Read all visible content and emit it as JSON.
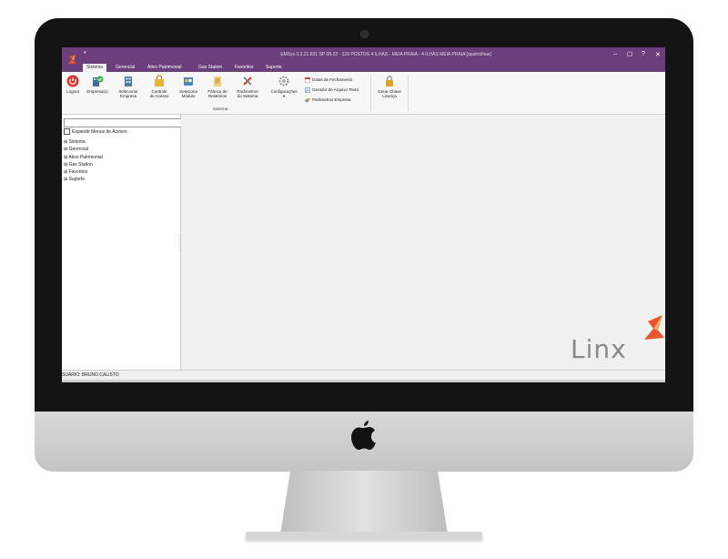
{
  "window": {
    "title": "EMSys 3.3.21.831 SP 08-22 - 126 POSTOS 4 ILHAS - MEIA PRAIA - 4 ILHAS MEIA PRAIA [quatroilhas]",
    "quick_access": "▾",
    "minimize": "–",
    "maximize": "☐",
    "help": "?",
    "close": "✕"
  },
  "tabs": [
    {
      "label": "Sistema",
      "active": true
    },
    {
      "label": "Gerencial"
    },
    {
      "label": "Ativo Patrimonial"
    },
    {
      "label": "Gas Station"
    },
    {
      "label": "Favoritos"
    },
    {
      "label": "Suporte"
    }
  ],
  "ribbon": {
    "buttons": [
      {
        "line1": "Logout",
        "line2": "",
        "icon": "power-icon"
      },
      {
        "line1": "Empresa(s)",
        "line2": "",
        "icon": "company-icon"
      },
      {
        "line1": "Selecionar",
        "line2": "Empresa",
        "icon": "building-icon"
      },
      {
        "line1": "Controle",
        "line2": "de Acesso",
        "icon": "lock-folder-icon"
      },
      {
        "line1": "Seleciona",
        "line2": "Módulo",
        "icon": "module-icon"
      },
      {
        "line1": "Fábrica de",
        "line2": "Relatórios",
        "icon": "report-icon"
      },
      {
        "line1": "Parâmetros",
        "line2": "do Sistema",
        "icon": "tools-icon"
      },
      {
        "line1": "Configurações",
        "line2": "▾",
        "icon": "gear-icon"
      }
    ],
    "group_label": "Sistema",
    "small_buttons": [
      {
        "label": "Datas de Fechamento",
        "icon": "calendar-icon"
      },
      {
        "label": "Gerador de Arquivo Texto",
        "icon": "text-file-icon"
      },
      {
        "label": "Parâmetros Empresa",
        "icon": "gears-icon"
      }
    ],
    "license": {
      "line1": "Gerar Chave",
      "line2": "Licença",
      "icon": "padlock-icon"
    }
  },
  "left_panel": {
    "search_value": "",
    "expand_checkbox_label": "Expandir Menus de Acesso",
    "expand_checked": false,
    "tree": [
      "Sistema",
      "Gerencial",
      "Ativo Patrimonial",
      "Gas Station",
      "Favoritos",
      "Suporte"
    ]
  },
  "status_bar": {
    "user_text": "SUÁRIO: BRUNO.CALISTO"
  },
  "brand": {
    "logo_text": "Linx"
  },
  "colors": {
    "title_bar": "#6a3f7b",
    "brand_accent": "#e8552c"
  }
}
